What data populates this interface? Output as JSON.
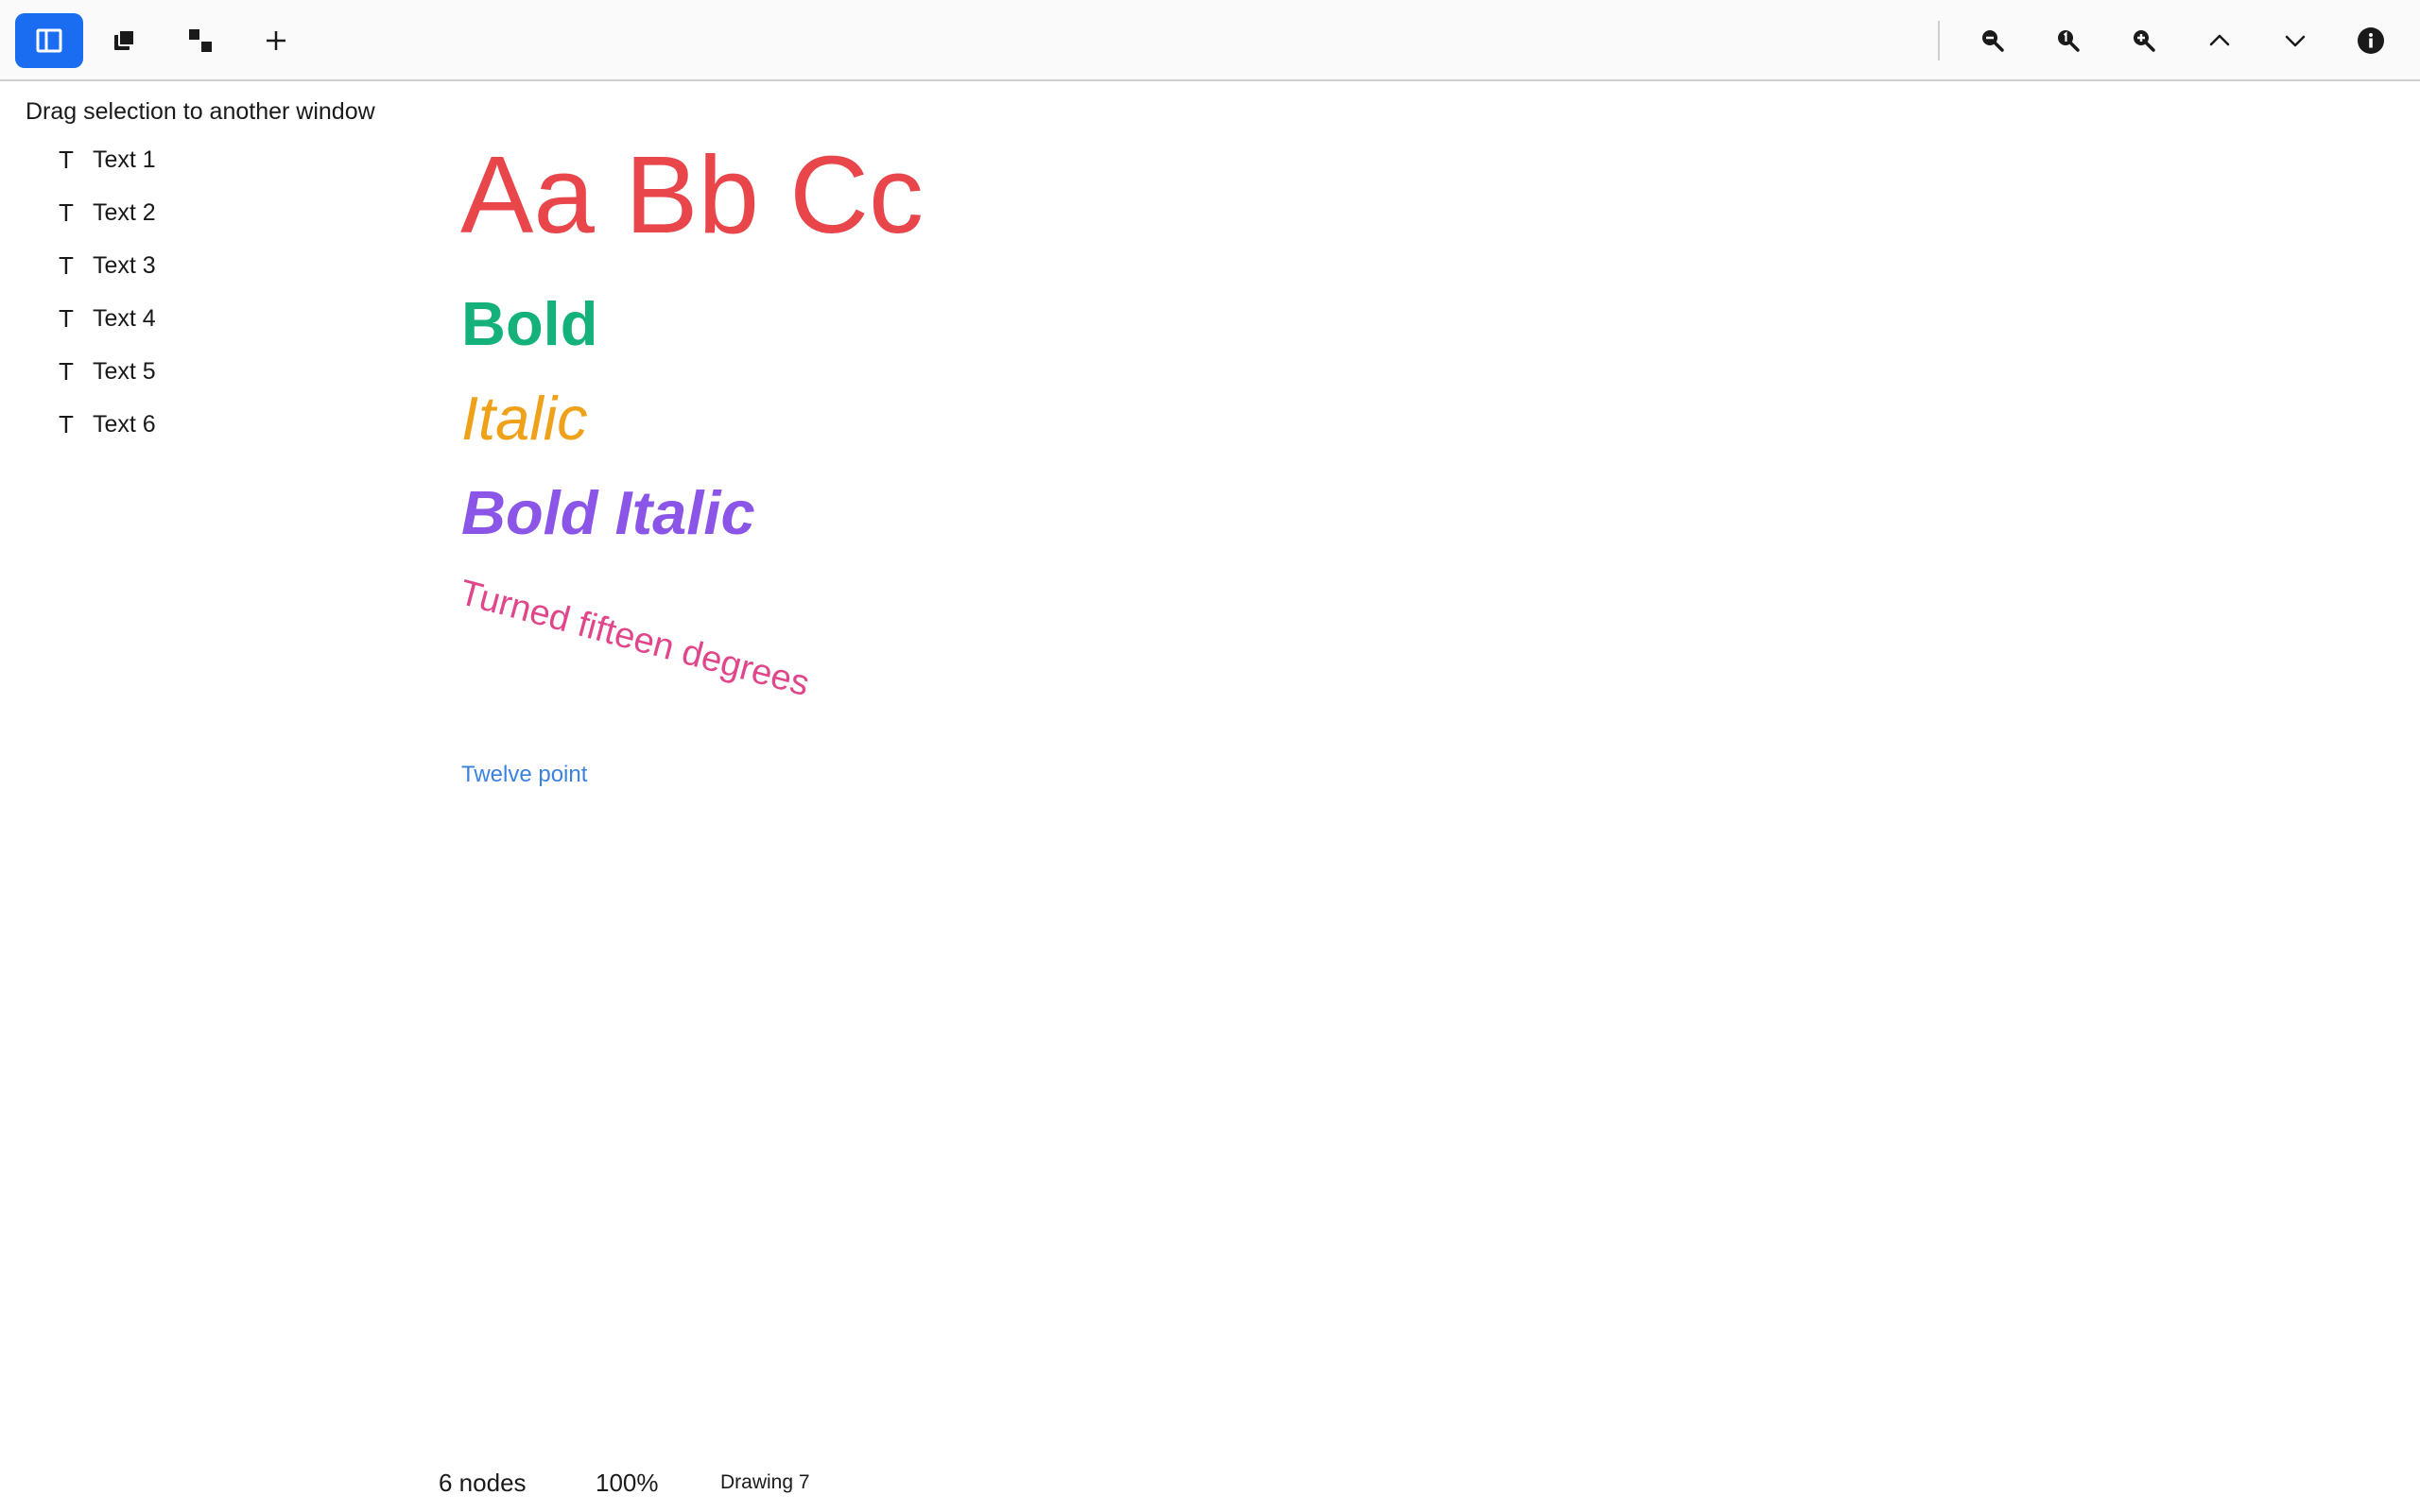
{
  "toolbar": {
    "left_buttons": [
      {
        "name": "toggle-sidebar-button",
        "icon": "sidebar-panel-icon",
        "active": true
      },
      {
        "name": "bring-to-front-button",
        "icon": "stack-front-icon",
        "active": false
      },
      {
        "name": "diagonal-arrange-button",
        "icon": "diagonal-squares-icon",
        "active": false
      },
      {
        "name": "add-button",
        "icon": "plus-icon",
        "active": false
      }
    ],
    "right_buttons": [
      {
        "name": "zoom-out-button",
        "icon": "zoom-out-icon"
      },
      {
        "name": "zoom-actual-button",
        "icon": "zoom-actual-icon"
      },
      {
        "name": "zoom-in-button",
        "icon": "zoom-in-icon"
      },
      {
        "name": "previous-button",
        "icon": "chevron-up-icon"
      },
      {
        "name": "next-button",
        "icon": "chevron-down-icon"
      },
      {
        "name": "info-button",
        "icon": "info-icon"
      }
    ]
  },
  "sidebar": {
    "header": "Drag selection to another window",
    "item_icon_glyph": "T",
    "items": [
      {
        "label": "Text 1"
      },
      {
        "label": "Text 2"
      },
      {
        "label": "Text 3"
      },
      {
        "label": "Text 4"
      },
      {
        "label": "Text 5"
      },
      {
        "label": "Text 6"
      }
    ]
  },
  "canvas": {
    "samples": [
      {
        "text": "Aa Bb Cc",
        "color": "#e8464b"
      },
      {
        "text": "Bold",
        "color": "#14b17a"
      },
      {
        "text": "Italic",
        "color": "#f0a11a"
      },
      {
        "text": "Bold Italic",
        "color": "#8b55e8"
      },
      {
        "text": "Turned fifteen degrees",
        "color": "#e0468a"
      },
      {
        "text": "Twelve point",
        "color": "#3a82e0"
      }
    ]
  },
  "status": {
    "nodes": "6 nodes",
    "zoom": "100%",
    "document": "Drawing 7"
  },
  "colors": {
    "accent": "#1a6cf0",
    "icon": "#1a1a1a"
  }
}
